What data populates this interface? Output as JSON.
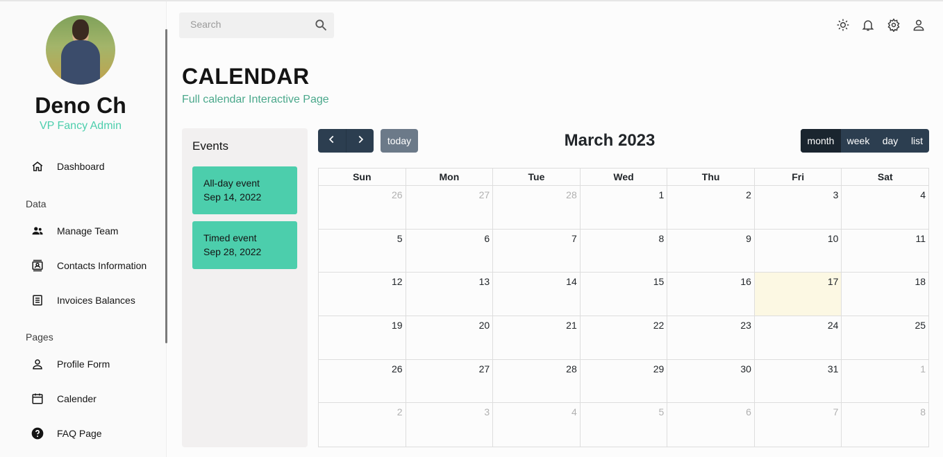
{
  "sidebar": {
    "user": {
      "name": "Deno Ch",
      "role": "VP Fancy Admin"
    },
    "items": [
      {
        "label": "Dashboard",
        "icon": "home-icon"
      },
      {
        "label": "Manage Team",
        "icon": "people-icon"
      },
      {
        "label": "Contacts Information",
        "icon": "contacts-icon"
      },
      {
        "label": "Invoices Balances",
        "icon": "receipt-icon"
      },
      {
        "label": "Profile Form",
        "icon": "person-icon"
      },
      {
        "label": "Calender",
        "icon": "calendar-icon"
      },
      {
        "label": "FAQ Page",
        "icon": "help-icon"
      }
    ],
    "sections": {
      "data": "Data",
      "pages": "Pages"
    }
  },
  "topbar": {
    "search_placeholder": "Search",
    "icons": [
      "light-mode-icon",
      "notifications-icon",
      "settings-icon",
      "person-icon"
    ]
  },
  "header": {
    "title": "CALENDAR",
    "subtitle": "Full calendar Interactive Page"
  },
  "events": {
    "title": "Events",
    "items": [
      {
        "title": "All-day event",
        "date": "Sep 14, 2022"
      },
      {
        "title": "Timed event",
        "date": "Sep 28, 2022"
      }
    ]
  },
  "calendar": {
    "title": "March 2023",
    "today_label": "today",
    "views": [
      "month",
      "week",
      "day",
      "list"
    ],
    "active_view": "month",
    "days_of_week": [
      "Sun",
      "Mon",
      "Tue",
      "Wed",
      "Thu",
      "Fri",
      "Sat"
    ],
    "weeks": [
      [
        [
          "26",
          true
        ],
        [
          "27",
          true
        ],
        [
          "28",
          true
        ],
        [
          "1",
          false
        ],
        [
          "2",
          false
        ],
        [
          "3",
          false
        ],
        [
          "4",
          false
        ]
      ],
      [
        [
          "5",
          false
        ],
        [
          "6",
          false
        ],
        [
          "7",
          false
        ],
        [
          "8",
          false
        ],
        [
          "9",
          false
        ],
        [
          "10",
          false
        ],
        [
          "11",
          false
        ]
      ],
      [
        [
          "12",
          false
        ],
        [
          "13",
          false
        ],
        [
          "14",
          false
        ],
        [
          "15",
          false
        ],
        [
          "16",
          false
        ],
        [
          "17",
          false
        ],
        [
          "18",
          false
        ]
      ],
      [
        [
          "19",
          false
        ],
        [
          "20",
          false
        ],
        [
          "21",
          false
        ],
        [
          "22",
          false
        ],
        [
          "23",
          false
        ],
        [
          "24",
          false
        ],
        [
          "25",
          false
        ]
      ],
      [
        [
          "26",
          false
        ],
        [
          "27",
          false
        ],
        [
          "28",
          false
        ],
        [
          "29",
          false
        ],
        [
          "30",
          false
        ],
        [
          "31",
          false
        ],
        [
          "1",
          true
        ]
      ],
      [
        [
          "2",
          true
        ],
        [
          "3",
          true
        ],
        [
          "4",
          true
        ],
        [
          "5",
          true
        ],
        [
          "6",
          true
        ],
        [
          "7",
          true
        ],
        [
          "8",
          true
        ]
      ]
    ],
    "today_date": "17",
    "colors": {
      "accent": "#4cceac",
      "button": "#2c3e50",
      "today_bg": "#fcf8e3"
    }
  }
}
